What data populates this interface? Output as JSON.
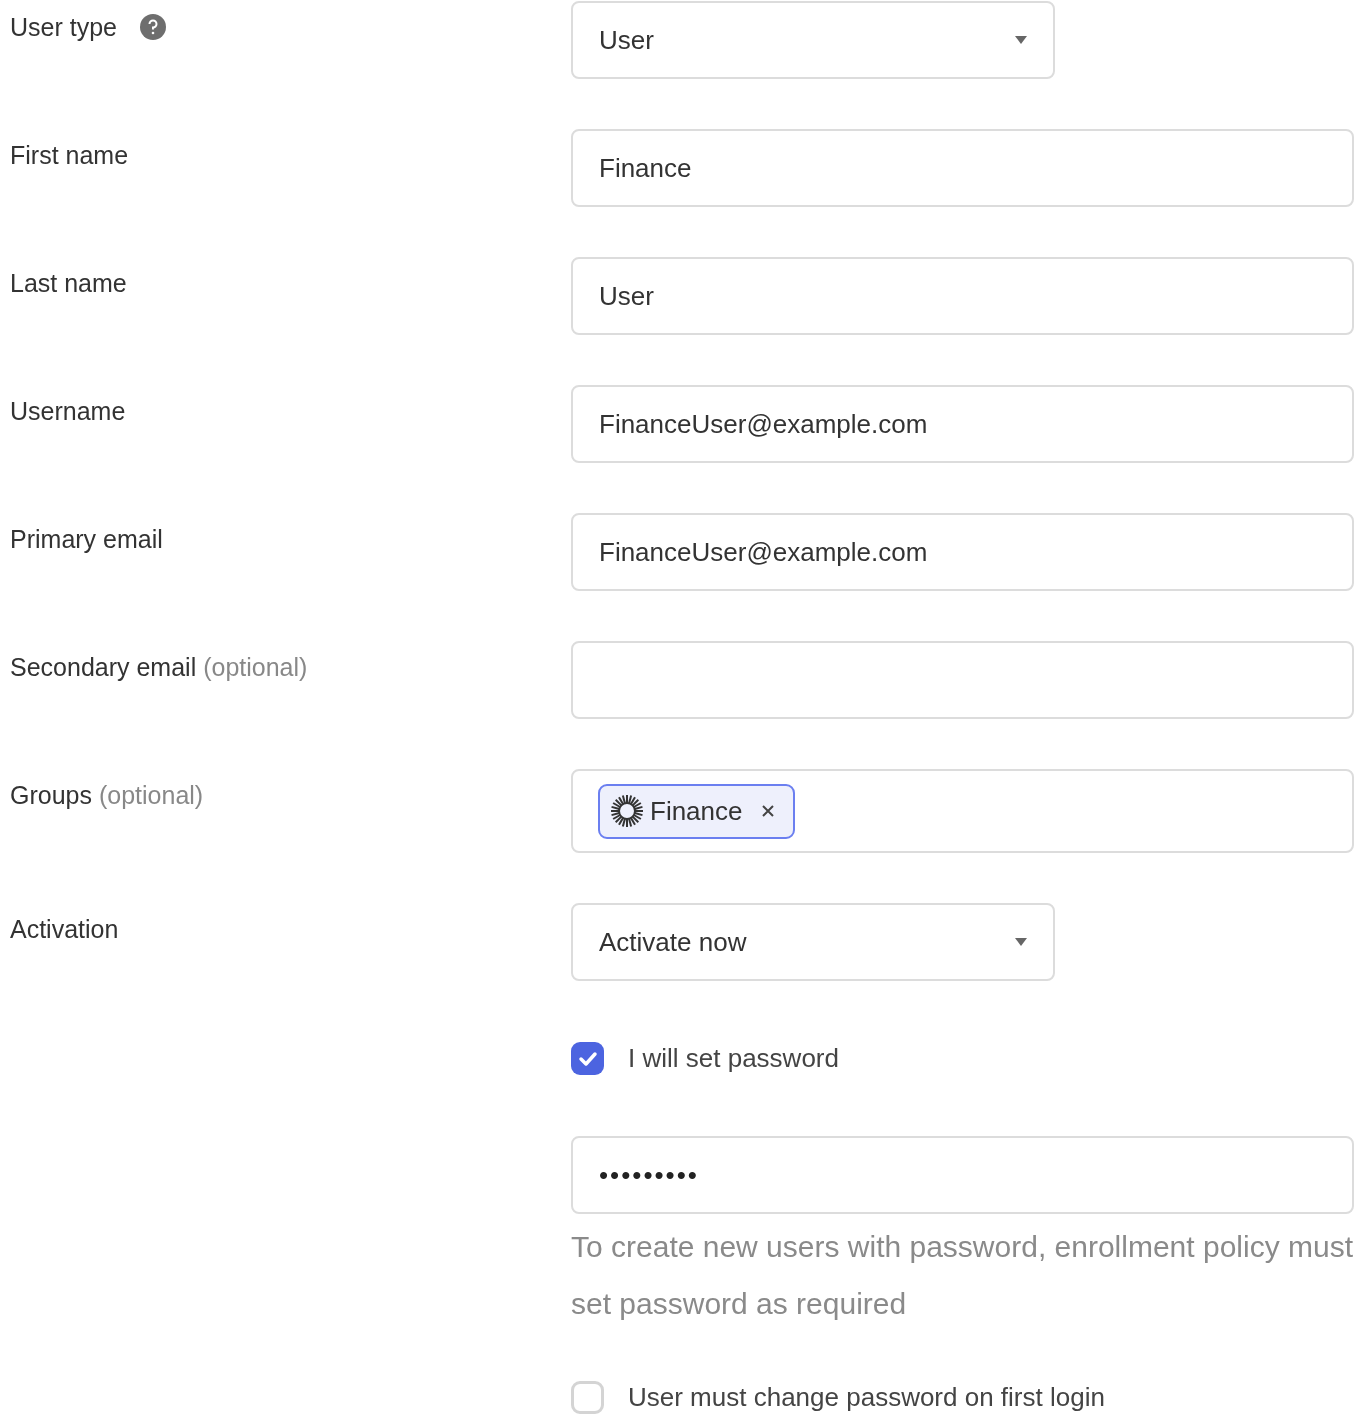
{
  "fields": [
    {
      "label": "User type",
      "has_help": true,
      "kind": "select",
      "value": "User"
    },
    {
      "label": "First name",
      "kind": "text",
      "value": "Finance"
    },
    {
      "label": "Last name",
      "kind": "text",
      "value": "User"
    },
    {
      "label": "Username",
      "kind": "text",
      "value": "FinanceUser@example.com"
    },
    {
      "label": "Primary email",
      "kind": "text",
      "value": "FinanceUser@example.com"
    },
    {
      "label": "Secondary email",
      "hint": "(optional)",
      "kind": "text"
    },
    {
      "label": "Groups",
      "hint": "(optional)",
      "kind": "tags",
      "tags": [
        "Finance"
      ]
    },
    {
      "label": "Activation",
      "kind": "select",
      "value": "Activate now"
    }
  ],
  "set_password": {
    "label": "I will set password",
    "checked": true
  },
  "password": {
    "value": "•••••••••"
  },
  "password_note": "To create new users with password, enrollment policy must set password as required",
  "must_change": {
    "label": "User must change password on first login",
    "checked": false
  }
}
